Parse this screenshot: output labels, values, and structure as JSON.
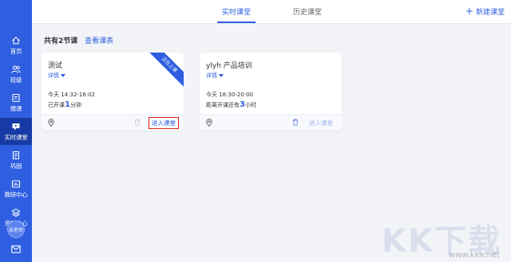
{
  "sidebar": {
    "items": [
      {
        "label": "首页",
        "icon": "home-icon"
      },
      {
        "label": "班级",
        "icon": "users-icon"
      },
      {
        "label": "微课",
        "icon": "book-icon"
      },
      {
        "label": "实时课堂",
        "icon": "live-classroom-icon",
        "active": true
      },
      {
        "label": "巩固",
        "icon": "document-icon"
      },
      {
        "label": "教研中心",
        "icon": "research-icon"
      },
      {
        "label": "资料中心",
        "icon": "layers-icon"
      }
    ],
    "avatar_text": "未老师"
  },
  "topbar": {
    "tab_live": "实时课堂",
    "tab_history": "历史课堂",
    "new_button": "新建课堂"
  },
  "main": {
    "count_text": "共有2节课",
    "view_schedule": "查看课表"
  },
  "cards": [
    {
      "title": "测试",
      "detail": "详情",
      "time": "今天 14:32-16:02",
      "status_pre": "已开课",
      "status_num": "1",
      "status_post": "分钟",
      "enter": "进入课堂",
      "ribbon": "正在上课"
    },
    {
      "title": "ylyh 产品培训",
      "detail": "详情",
      "time": "今天 18:30-20:00",
      "status_pre": "距离开课还有",
      "status_num": "3",
      "status_post": "小时",
      "enter": "进入课堂"
    }
  ],
  "watermark": {
    "text": "KK下载",
    "url": "www.kkx.net"
  },
  "colors": {
    "primary": "#2f5fe0",
    "sidebar_active": "#173aa6",
    "highlight_box": "#e02020"
  }
}
